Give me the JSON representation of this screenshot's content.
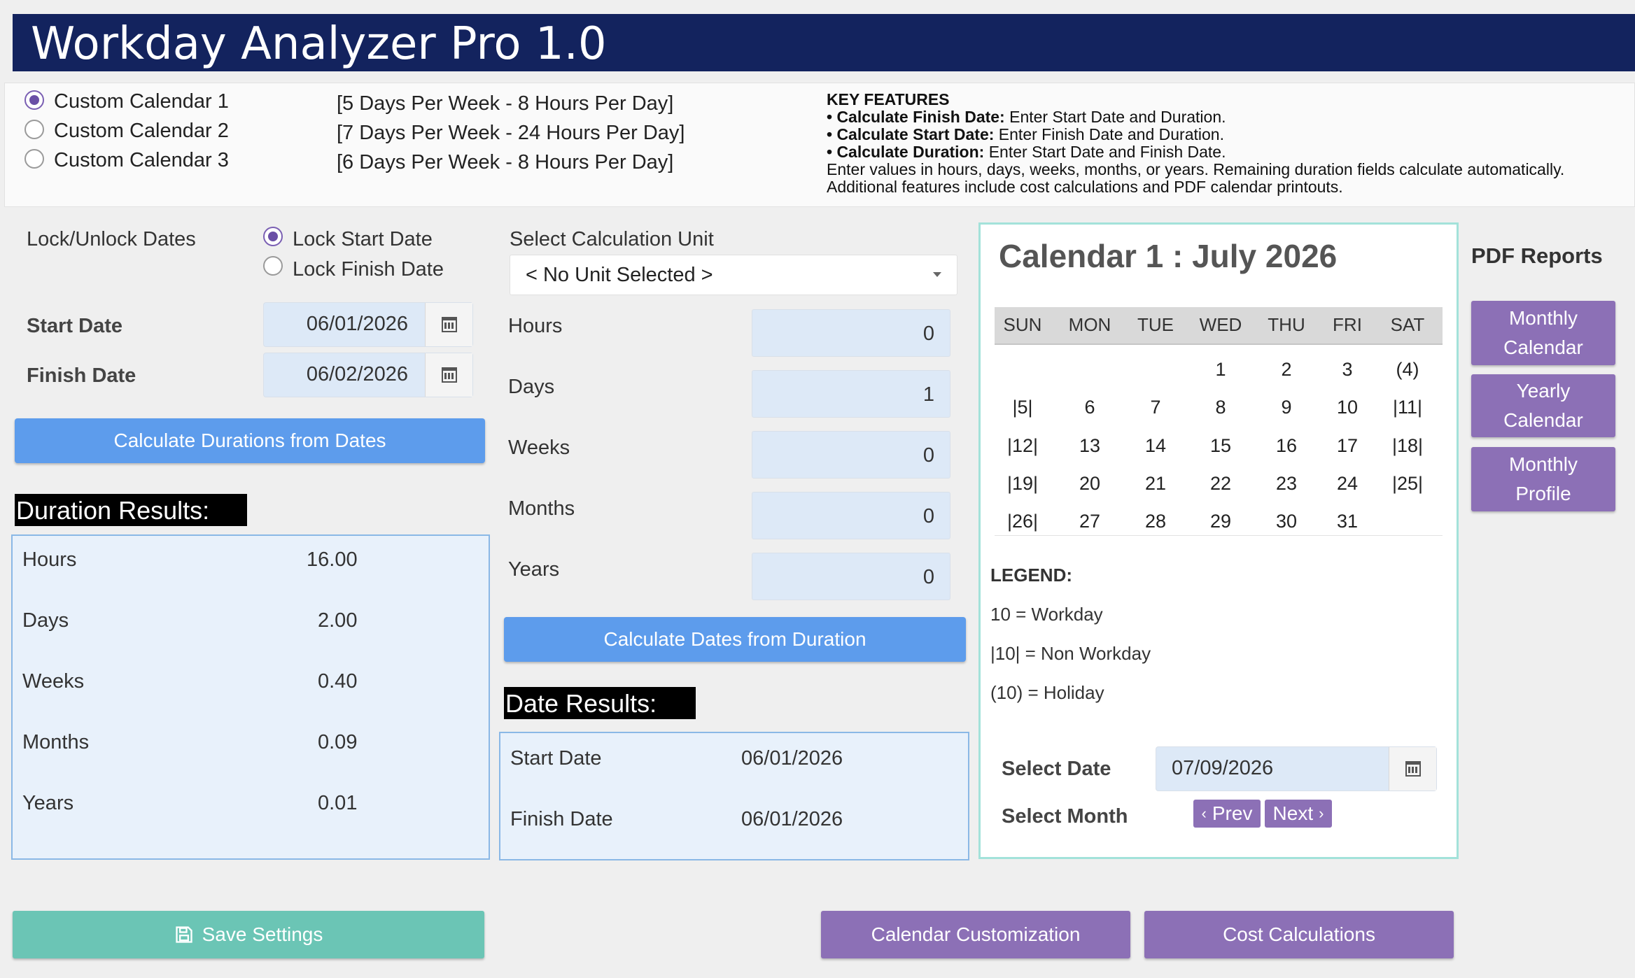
{
  "app": {
    "title": "Workday Analyzer Pro 1.0"
  },
  "calendars": [
    {
      "label": "Custom Calendar 1",
      "desc": "[5 Days Per Week - 8 Hours Per Day]",
      "selected": true
    },
    {
      "label": "Custom Calendar 2",
      "desc": "[7 Days Per Week - 24 Hours Per Day]",
      "selected": false
    },
    {
      "label": "Custom Calendar 3",
      "desc": "[6 Days Per Week - 8 Hours Per Day]",
      "selected": false
    }
  ],
  "key_features": {
    "heading": "KEY FEATURES",
    "items": [
      {
        "bold": "• Calculate Finish Date:",
        "text": " Enter Start Date and Duration."
      },
      {
        "bold": "• Calculate Start Date:",
        "text": " Enter Finish Date and Duration."
      },
      {
        "bold": "• Calculate Duration:",
        "text": " Enter Start Date and Finish Date."
      }
    ],
    "note1": "Enter values in hours, days, weeks, months, or years. Remaining duration fields calculate automatically.",
    "note2": "Additional features include cost calculations and PDF calendar printouts."
  },
  "lock": {
    "label": "Lock/Unlock Dates",
    "options": [
      {
        "label": "Lock Start Date",
        "selected": true
      },
      {
        "label": "Lock Finish Date",
        "selected": false
      }
    ]
  },
  "dates": {
    "start_label": "Start Date",
    "start_value": "06/01/2026",
    "finish_label": "Finish Date",
    "finish_value": "06/02/2026"
  },
  "buttons": {
    "calc_durations": "Calculate Durations from Dates",
    "calc_dates": "Calculate Dates from Duration",
    "save_settings": "Save Settings",
    "calendar_customization": "Calendar Customization",
    "cost_calculations": "Cost Calculations"
  },
  "duration_results": {
    "title": "Duration Results:",
    "rows": [
      {
        "label": "Hours",
        "value": "16.00"
      },
      {
        "label": "Days",
        "value": "2.00"
      },
      {
        "label": "Weeks",
        "value": "0.40"
      },
      {
        "label": "Months",
        "value": "0.09"
      },
      {
        "label": "Years",
        "value": "0.01"
      }
    ]
  },
  "calc_unit": {
    "label": "Select Calculation Unit",
    "selected": "< No Unit Selected >",
    "fields": [
      {
        "label": "Hours",
        "value": "0"
      },
      {
        "label": "Days",
        "value": "1"
      },
      {
        "label": "Weeks",
        "value": "0"
      },
      {
        "label": "Months",
        "value": "0"
      },
      {
        "label": "Years",
        "value": "0"
      }
    ]
  },
  "date_results": {
    "title": "Date Results:",
    "start_label": "Start Date",
    "start_value": "06/01/2026",
    "finish_label": "Finish Date",
    "finish_value": "06/01/2026"
  },
  "calendar": {
    "title": "Calendar 1 : July 2026",
    "dow": [
      "SUN",
      "MON",
      "TUE",
      "WED",
      "THU",
      "FRI",
      "SAT"
    ],
    "weeks": [
      [
        "",
        "",
        "",
        "1",
        "2",
        "3",
        "(4)"
      ],
      [
        "|5|",
        "6",
        "7",
        "8",
        "9",
        "10",
        "|11|"
      ],
      [
        "|12|",
        "13",
        "14",
        "15",
        "16",
        "17",
        "|18|"
      ],
      [
        "|19|",
        "20",
        "21",
        "22",
        "23",
        "24",
        "|25|"
      ],
      [
        "|26|",
        "27",
        "28",
        "29",
        "30",
        "31",
        ""
      ]
    ],
    "legend_title": "LEGEND:",
    "legend": [
      "10 = Workday",
      "|10| = Non Workday",
      "(10) = Holiday"
    ],
    "select_date_label": "Select Date",
    "select_date_value": "07/09/2026",
    "select_month_label": "Select Month",
    "prev": "Prev",
    "next": "Next"
  },
  "pdf_reports": {
    "title": "PDF Reports",
    "buttons": [
      {
        "line1": "Monthly",
        "line2": "Calendar"
      },
      {
        "line1": "Yearly",
        "line2": "Calendar"
      },
      {
        "line1": "Monthly",
        "line2": "Profile"
      }
    ]
  },
  "colors": {
    "header_bg": "#13235e",
    "blue_button": "#5d9cec",
    "purple_button": "#8c70b6",
    "green_button": "#6bc5b5",
    "calendar_border": "#a3e2da"
  }
}
